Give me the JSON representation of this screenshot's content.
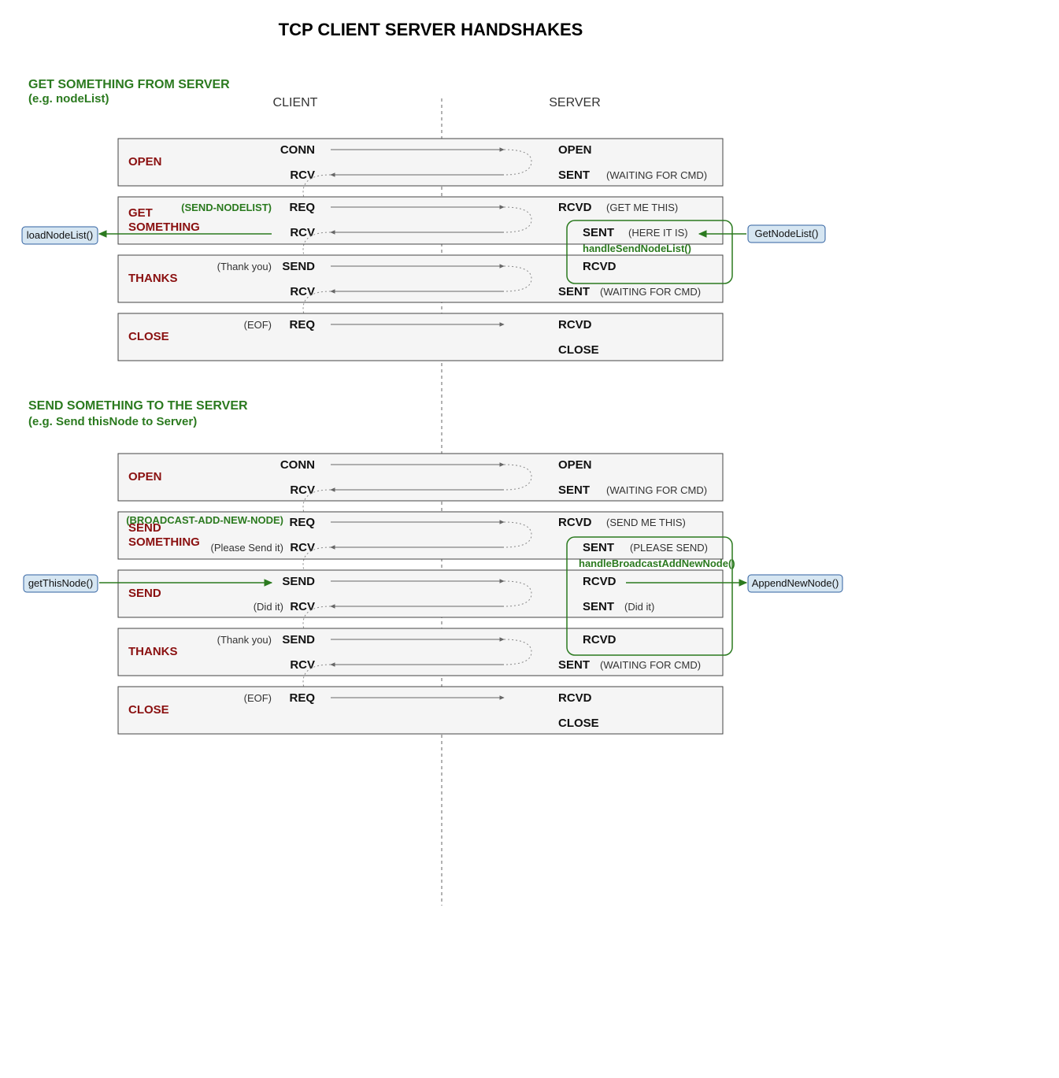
{
  "title": "TCP CLIENT SERVER HANDSHAKES",
  "columns": {
    "client": "CLIENT",
    "server": "SERVER"
  },
  "sections": {
    "get": {
      "heading": "GET SOMETHING FROM SERVER",
      "sub": "(e.g. nodeList)"
    },
    "send": {
      "heading": "SEND SOMETHING TO THE SERVER",
      "sub": "(e.g. Send thisNode to Server)"
    }
  },
  "stages": {
    "open": "OPEN",
    "getSomething": "GET\nSOMETHING",
    "thanks": "THANKS",
    "close": "CLOSE",
    "sendSomething": "SEND\nSOMETHING",
    "send": "SEND"
  },
  "client": {
    "conn": "CONN",
    "rcv": "RCV",
    "req": "REQ",
    "send": "SEND",
    "sendNodelist": "(SEND-NODELIST)",
    "broadcast": "(BROADCAST-ADD-NEW-NODE)",
    "pleaseSend": "(Please Send it)",
    "didIt": "(Did it)",
    "thankYou": "(Thank you)",
    "eof": "(EOF)"
  },
  "server": {
    "open": "OPEN",
    "sent": "SENT",
    "rcvd": "RCVD",
    "close": "CLOSE",
    "waitCmd": "(WAITING FOR CMD)",
    "getMeThis": "(GET ME THIS)",
    "hereItIs": "(HERE IT IS)",
    "sendMeThis": "(SEND ME THIS)",
    "pleaseSend": "(PLEASE SEND)",
    "didIt": "(Did it)"
  },
  "handlers": {
    "handleSendNodeList": "handleSendNodeList()",
    "handleBroadcast": "handleBroadcastAddNewNode()"
  },
  "fns": {
    "loadNodeList": "loadNodeList()",
    "getNodeList": "GetNodeList()",
    "getThisNode": "getThisNode()",
    "appendNewNode": "AppendNewNode()"
  }
}
